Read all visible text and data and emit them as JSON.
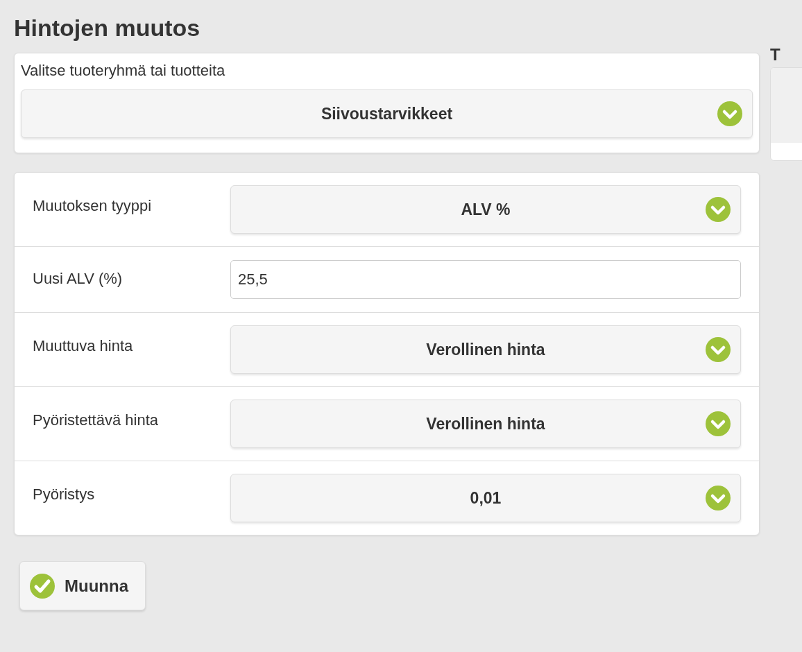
{
  "title": "Hintojen muutos",
  "product_group": {
    "label": "Valitse tuoteryhmä tai tuotteita",
    "value": "Siivoustarvikkeet"
  },
  "fields": [
    {
      "kind": "select",
      "label": "Muutoksen tyyppi",
      "value": "ALV %"
    },
    {
      "kind": "input",
      "label": "Uusi ALV (%)",
      "value": "25,5"
    },
    {
      "kind": "select",
      "label": "Muuttuva hinta",
      "value": "Verollinen hinta"
    },
    {
      "kind": "select",
      "label": "Pyöristettävä hinta",
      "value": "Verollinen hinta"
    },
    {
      "kind": "select",
      "label": "Pyöristys",
      "value": "0,01"
    }
  ],
  "submit_button": "Muunna",
  "side_panel": {
    "title": "T"
  }
}
